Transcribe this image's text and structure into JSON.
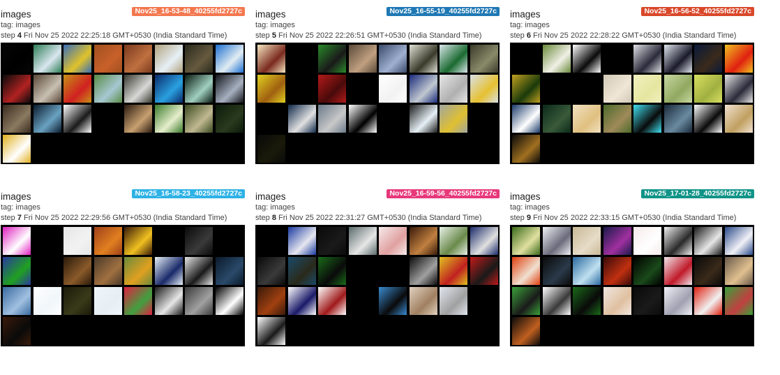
{
  "cards": [
    {
      "title": "images",
      "run": "Nov25_16-53-48_40255fd2727c",
      "run_color": "#f4784f",
      "tag": "tag: images",
      "step_label": "step",
      "step": "4",
      "time": "Fri Nov 25 2022 22:25:18 GMT+0530 (India Standard Time)",
      "thumb_count": 25,
      "thumbs": [
        [
          "#060606",
          "#000000"
        ],
        [
          "#2e7d57",
          "#d9e6ee"
        ],
        [
          "#3a6fb6",
          "#e0c22b"
        ],
        [
          "#a05020",
          "#c8602a"
        ],
        [
          "#7a3a1e",
          "#c07040"
        ],
        [
          "#b2a27e",
          "#e6f0f6"
        ],
        [
          "#2a2a1e",
          "#665a3e"
        ],
        [
          "#1e6fd0",
          "#e0ecf2"
        ],
        [
          "#0a0a0a",
          "#b22222"
        ],
        [
          "#5a4636",
          "#c8c0b2"
        ],
        [
          "#c79018",
          "#d02020"
        ],
        [
          "#5a8c46",
          "#a6c8d2"
        ],
        [
          "#3a3a32",
          "#d8d8d6"
        ],
        [
          "#0a2a6a",
          "#2aa0e0"
        ],
        [
          "#0a1a10",
          "#a0d0c0"
        ],
        [
          "#12141a",
          "#a6b0c0"
        ],
        [
          "#3a2a1e",
          "#8a7a60"
        ],
        [
          "#0a1a2a",
          "#6aa2c2"
        ],
        [
          "#ffffff",
          "#1a1a1a"
        ],
        [
          "#000000",
          "#000000"
        ],
        [
          "#2a1a10",
          "#c8a070"
        ],
        [
          "#3a7a2a",
          "#e6eecc"
        ],
        [
          "#3a4a20",
          "#c0b890"
        ],
        [
          "#0a1a0a",
          "#2a3a1e"
        ],
        [
          "#e0b020",
          "#ffffff"
        ]
      ]
    },
    {
      "title": "images",
      "run": "Nov25_16-55-19_40255fd2727c",
      "run_color": "#1f78b4",
      "tag": "tag: images",
      "step_label": "step",
      "step": "5",
      "time": "Fri Nov 25 2022 22:26:51 GMT+0530 (India Standard Time)",
      "thumb_count": 25,
      "thumbs": [
        [
          "#f6e6c0",
          "#7a2a1e"
        ],
        [
          "#000000",
          "#000000"
        ],
        [
          "#2a8a2a",
          "#1a1a1a"
        ],
        [
          "#5a4a3a",
          "#c0a080"
        ],
        [
          "#3a4a6a",
          "#a0b0d0"
        ],
        [
          "#e0e0d6",
          "#3a3a2a"
        ],
        [
          "#d8e6ea",
          "#1a6a30"
        ],
        [
          "#3a3a2a",
          "#8a8a6a"
        ],
        [
          "#e0d020",
          "#a06010"
        ],
        [
          "#000000",
          "#000000"
        ],
        [
          "#b21a1a",
          "#4a0a0a"
        ],
        [
          "#000000",
          "#000000"
        ],
        [
          "#ffffff",
          "#f2f2f2"
        ],
        [
          "#1a2a7a",
          "#c0c8d0"
        ],
        [
          "#e6e6e6",
          "#b0b0b0"
        ],
        [
          "#d8e0e6",
          "#e6c030"
        ],
        [
          "#000000",
          "#000000"
        ],
        [
          "#102a4a",
          "#e0e0e0"
        ],
        [
          "#6a7a8a",
          "#c8c8c8"
        ],
        [
          "#ffffff",
          "#000000"
        ],
        [
          "#000000",
          "#000000"
        ],
        [
          "#1a1a1a",
          "#e6f0f6"
        ],
        [
          "#a0a6a0",
          "#e0c030"
        ],
        [
          "#000000",
          "#000000"
        ],
        [
          "#0a0a0a",
          "#1a1a0a"
        ]
      ]
    },
    {
      "title": "images",
      "run": "Nov25_16-56-52_40255fd2727c",
      "run_color": "#d9482a",
      "tag": "tag: images",
      "step_label": "step",
      "step": "6",
      "time": "Fri Nov 25 2022 22:28:22 GMT+0530 (India Standard Time)",
      "thumb_count": 25,
      "thumbs": [
        [
          "#000000",
          "#000000"
        ],
        [
          "#6a8a3a",
          "#f0f0e6"
        ],
        [
          "#ffffff",
          "#0a0a0a"
        ],
        [
          "#000000",
          "#000000"
        ],
        [
          "#e0e0e6",
          "#2a2a3a"
        ],
        [
          "#e0e6ee",
          "#1a1a2a"
        ],
        [
          "#0a1a3a",
          "#3a2a1a"
        ],
        [
          "#f0c020",
          "#e02010"
        ],
        [
          "#c0a020",
          "#1a3a0a"
        ],
        [
          "#000000",
          "#000000"
        ],
        [
          "#000000",
          "#000000"
        ],
        [
          "#d0c8b8",
          "#f0e6d6"
        ],
        [
          "#f0f0c0",
          "#e6e6a0"
        ],
        [
          "#c8d8a0",
          "#90a860"
        ],
        [
          "#d8e060",
          "#a0b040"
        ],
        [
          "#e6e6e6",
          "#2a2a3a"
        ],
        [
          "#1a3a6a",
          "#ffffff"
        ],
        [
          "#0a2a1a",
          "#3a5a3a"
        ],
        [
          "#f0e0c0",
          "#e0c080"
        ],
        [
          "#4a6a2a",
          "#a08a5a"
        ],
        [
          "#40e0f0",
          "#0a0a0a"
        ],
        [
          "#1a2a3a",
          "#6a8aa0"
        ],
        [
          "#ffffff",
          "#0a0a0a"
        ],
        [
          "#f0e0d0",
          "#c0a060"
        ],
        [
          "#0a0a0a",
          "#a07020"
        ]
      ]
    },
    {
      "title": "images",
      "run": "Nov25_16-58-23_40255fd2727c",
      "run_color": "#2db2e6",
      "tag": "tag: images",
      "step_label": "step",
      "step": "7",
      "time": "Fri Nov 25 2022 22:29:56 GMT+0530 (India Standard Time)",
      "thumb_count": 25,
      "thumbs": [
        [
          "#e020c0",
          "#ffffff"
        ],
        [
          "#000000",
          "#000000"
        ],
        [
          "#e6e6e6",
          "#f2f2f2"
        ],
        [
          "#a0401a",
          "#e08020"
        ],
        [
          "#3a1a0a",
          "#f0c020"
        ],
        [
          "#000000",
          "#000000"
        ],
        [
          "#0a0a0a",
          "#3a3a3a"
        ],
        [
          "#000000",
          "#000000"
        ],
        [
          "#2a3aa0",
          "#20a020"
        ],
        [
          "#000000",
          "#000000"
        ],
        [
          "#2a1a0a",
          "#8a5a2a"
        ],
        [
          "#4a3a2a",
          "#a07040"
        ],
        [
          "#6a8a3a",
          "#e0a020"
        ],
        [
          "#e6f0f6",
          "#1a2a6a"
        ],
        [
          "#e6e6e6",
          "#1a1a1a"
        ],
        [
          "#0a1a2a",
          "#2a4a6a"
        ],
        [
          "#3a6aa0",
          "#a0c0e0"
        ],
        [
          "#ffffff",
          "#f0f6fa"
        ],
        [
          "#1a1a0a",
          "#3a3a1a"
        ],
        [
          "#f0f6fa",
          "#e6eef4"
        ],
        [
          "#e02040",
          "#40a040"
        ],
        [
          "#1a1a1a",
          "#e6e6e6"
        ],
        [
          "#3a3a3a",
          "#a0a0a0"
        ],
        [
          "#000000",
          "#ffffff"
        ],
        [
          "#3a1a0a",
          "#0a0a0a"
        ]
      ]
    },
    {
      "title": "images",
      "run": "Nov25_16-59-56_40255fd2727c",
      "run_color": "#e7387a",
      "tag": "tag: images",
      "step_label": "step",
      "step": "8",
      "time": "Fri Nov 25 2022 22:31:27 GMT+0530 (India Standard Time)",
      "thumb_count": 25,
      "thumbs": [
        [
          "#000000",
          "#000000"
        ],
        [
          "#1a3aa0",
          "#e6e6f0"
        ],
        [
          "#0a0a0a",
          "#1a1a1a"
        ],
        [
          "#5a6a6a",
          "#e6e6e6"
        ],
        [
          "#f6eaea",
          "#e0a0a0"
        ],
        [
          "#3a1a0a",
          "#c08040"
        ],
        [
          "#e6f0e6",
          "#6a8a4a"
        ],
        [
          "#1a2a6a",
          "#e0e0e0"
        ],
        [
          "#0a0a0a",
          "#3a3a3a"
        ],
        [
          "#1a4a6a",
          "#2a2a1a"
        ],
        [
          "#1a6a1a",
          "#0a0a0a"
        ],
        [
          "#000000",
          "#000000"
        ],
        [
          "#000000",
          "#000000"
        ],
        [
          "#0a0a0a",
          "#a0a0a0"
        ],
        [
          "#e0c020",
          "#c02020"
        ],
        [
          "#c01a1a",
          "#1a1a1a"
        ],
        [
          "#3a1a0a",
          "#a04010"
        ],
        [
          "#ffffff",
          "#1a1a6a"
        ],
        [
          "#ffffff",
          "#a01a1a"
        ],
        [
          "#000000",
          "#000000"
        ],
        [
          "#3a8ad0",
          "#0a0a0a"
        ],
        [
          "#e0d0c0",
          "#a08060"
        ],
        [
          "#e0e6ee",
          "#a0a0a0"
        ],
        [
          "#000000",
          "#000000"
        ],
        [
          "#ffffff",
          "#1a1a1a"
        ]
      ]
    },
    {
      "title": "images",
      "run": "Nov25_17-01-28_40255fd2727c",
      "run_color": "#109488",
      "tag": "tag: images",
      "step_label": "step",
      "step": "9",
      "time": "Fri Nov 25 2022 22:33:15 GMT+0530 (India Standard Time)",
      "thumb_count": 25,
      "thumbs": [
        [
          "#3a6a1a",
          "#e0e0a0"
        ],
        [
          "#f0f0f6",
          "#6a6a7a"
        ],
        [
          "#c8b896",
          "#e6dcc8"
        ],
        [
          "#1a1a4a",
          "#a030a0"
        ],
        [
          "#f6eaea",
          "#ffffff"
        ],
        [
          "#f0f0f0",
          "#2a2a2a"
        ],
        [
          "#1a1a1a",
          "#e6e6e6"
        ],
        [
          "#2a4a8a",
          "#f0f0f6"
        ],
        [
          "#e04010",
          "#f0e0d0"
        ],
        [
          "#0a0a0a",
          "#2a3a4a"
        ],
        [
          "#2a6aa0",
          "#c0e0f0"
        ],
        [
          "#3a0a0a",
          "#c03010"
        ],
        [
          "#000000",
          "#1a4a1a"
        ],
        [
          "#f0e6ea",
          "#c01a2a"
        ],
        [
          "#0a0a0a",
          "#3a2a1a"
        ],
        [
          "#6a5a4a",
          "#e0c090"
        ],
        [
          "#3aa03a",
          "#1a1a1a"
        ],
        [
          "#ffffff",
          "#3a3a3a"
        ],
        [
          "#1a6a1a",
          "#0a0a0a"
        ],
        [
          "#f0e6e0",
          "#e0c0a0"
        ],
        [
          "#0a0a0a",
          "#1a1a1a"
        ],
        [
          "#f0f0f6",
          "#a0a0b0"
        ],
        [
          "#e02010",
          "#f0f0f0"
        ],
        [
          "#3aa03a",
          "#c04040"
        ],
        [
          "#0a0a0a",
          "#c06020"
        ]
      ]
    }
  ]
}
